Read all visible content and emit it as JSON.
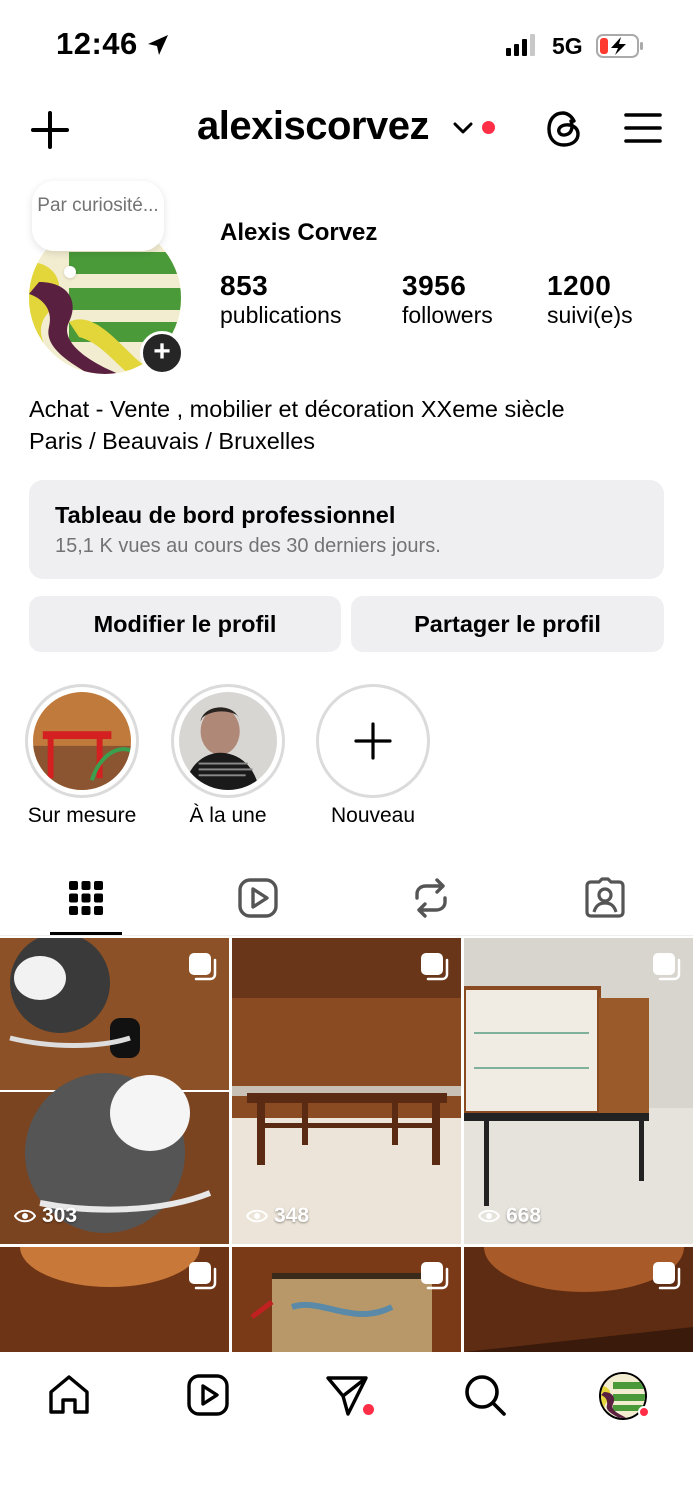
{
  "status_bar": {
    "time": "12:46",
    "network": "5G"
  },
  "header": {
    "username": "alexiscorvez"
  },
  "profile": {
    "note": "Par curiosité...",
    "full_name": "Alexis Corvez",
    "stats": [
      {
        "value": "853",
        "label": "publications"
      },
      {
        "value": "3956",
        "label": "followers"
      },
      {
        "value": "1200",
        "label": "suivi(e)s"
      }
    ],
    "bio_line1": "Achat - Vente , mobilier et décoration XXeme siècle",
    "bio_line2": "Paris / Beauvais / Bruxelles"
  },
  "dashboard": {
    "title": "Tableau de bord professionnel",
    "subtitle": "15,1 K vues au cours des 30 derniers jours."
  },
  "buttons": {
    "edit": "Modifier le profil",
    "share": "Partager le profil"
  },
  "highlights": [
    {
      "label": "Sur mesure"
    },
    {
      "label": "À la une"
    },
    {
      "label": "Nouveau"
    }
  ],
  "grid": {
    "views": [
      "303",
      "348",
      "668"
    ]
  },
  "colors": {
    "accent_red": "#ff2d46",
    "button_bg": "#efeff2"
  }
}
